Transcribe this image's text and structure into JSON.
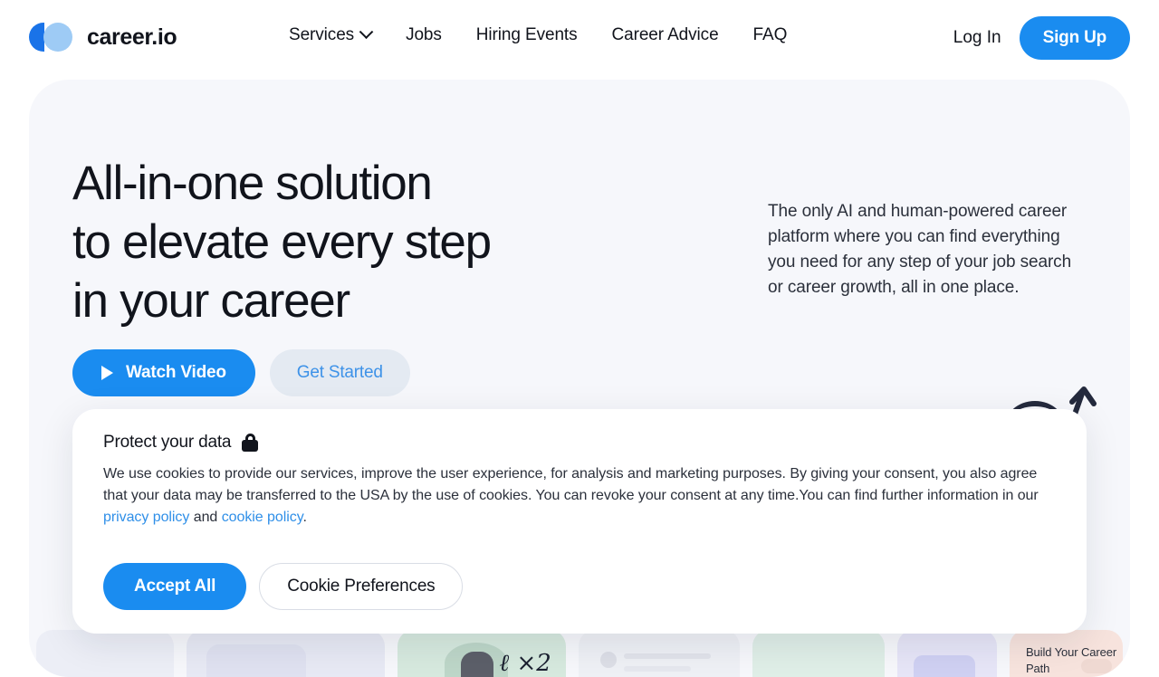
{
  "header": {
    "brand": {
      "name": "career.io",
      "logo_icon": "career-io-logo-icon"
    },
    "nav": [
      {
        "label": "Services",
        "has_dropdown": true,
        "icon": "chevron-down-icon"
      },
      {
        "label": "Jobs",
        "has_dropdown": false
      },
      {
        "label": "Hiring Events",
        "has_dropdown": false
      },
      {
        "label": "Career Advice",
        "has_dropdown": false
      },
      {
        "label": "FAQ",
        "has_dropdown": false
      }
    ],
    "login_label": "Log In",
    "signup_label": "Sign Up"
  },
  "hero": {
    "title": "All-in-one solution\nto elevate every step\nin your career",
    "subtitle": "The only AI and human-powered career platform where you can find everything you need for any step of your job search or career growth, all in one place.",
    "watch_video_label": "Watch Video",
    "watch_video_icon": "play-icon",
    "get_started_label": "Get Started"
  },
  "cards": {
    "career_path_label": "Build Your Career Path",
    "script_mark": "ℓ ×2"
  },
  "cookie_banner": {
    "title": "Protect your data",
    "title_icon": "lock-icon",
    "body_part1": "We use cookies to provide our services, improve the user experience, for analysis and marketing purposes. By giving your consent, you also agree that your data may be transferred to the USA by the use of cookies. You can revoke your consent at any time.You can find further information in our ",
    "privacy_link": "privacy policy",
    "body_conjunction": " and ",
    "cookie_link": "cookie policy",
    "body_end": ".",
    "accept_label": "Accept All",
    "preferences_label": "Cookie Preferences"
  },
  "colors": {
    "accent_blue": "#1a8cf0",
    "logo_dark_blue": "#1a73e8",
    "logo_light_blue": "#9ecbf5",
    "hero_bg": "#f6f7fb",
    "text_dark": "#11141c",
    "link_blue": "#2f8fe8",
    "get_started_bg": "#e4eaf2"
  }
}
